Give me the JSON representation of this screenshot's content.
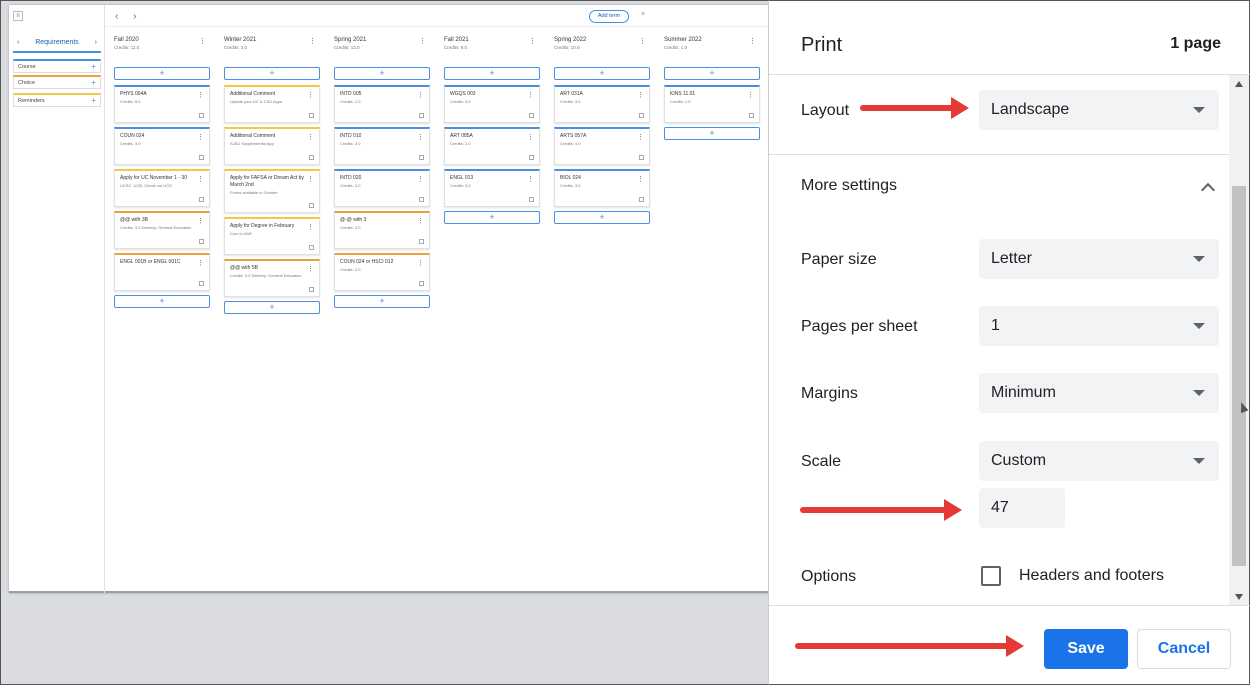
{
  "planner": {
    "sidebar": {
      "menu_icon": "≡",
      "requirements_label": "Requirements",
      "items": [
        {
          "label": "Course",
          "color": "#4a8fe0"
        },
        {
          "label": "Choice",
          "color": "#e8a33c"
        },
        {
          "label": "Reminders",
          "color": "#f0c94a"
        }
      ]
    },
    "add_term_label": "Add term",
    "close_glyph": "×",
    "terms": [
      {
        "name": "Fall 2020",
        "credits": "Credits: 11.0",
        "cards": [
          {
            "title": "PHYS 004A",
            "sub": "Credits: 5.0",
            "color": "#4a8fe0"
          },
          {
            "title": "COUN 024",
            "sub": "Credits: 3.0",
            "color": "#4a8fe0"
          },
          {
            "title": "Apply for UC November 1 - 30",
            "sub": "UCSC, UCB, Check out UCD",
            "color": "#f0c94a"
          },
          {
            "title": "@@ with 3B",
            "sub": "Credits: 3.0 Delivery: General Education",
            "color": "#e8a33c"
          },
          {
            "title": "ENGL 001B or ENGL 001C",
            "sub": "",
            "color": "#e8a33c"
          }
        ]
      },
      {
        "name": "Winter 2021",
        "credits": "Credits: 3.0",
        "cards": [
          {
            "title": "Additional Comment",
            "sub": "Update your UC & CSU Apps",
            "color": "#f0c94a"
          },
          {
            "title": "Additional Comment",
            "sub": "SJSU Supplemental App",
            "color": "#f0c94a"
          },
          {
            "title": "Apply for FAFSA or Dream Act by March 2nd",
            "sub": "Forms available in October",
            "color": "#f0c94a"
          },
          {
            "title": "Apply for Degree in February",
            "sub": "Cum in AAR",
            "color": "#f0c94a"
          },
          {
            "title": "@@ with 5B",
            "sub": "Credits: 3.0 Delivery: General Education",
            "color": "#e8a33c"
          }
        ]
      },
      {
        "name": "Spring 2021",
        "credits": "Credits: 13.0",
        "cards": [
          {
            "title": "INTD 005",
            "sub": "Credits: 1.0",
            "color": "#4a8fe0"
          },
          {
            "title": "INTD 010",
            "sub": "Credits: 3.0",
            "color": "#4a8fe0"
          },
          {
            "title": "INTD 020",
            "sub": "Credits: 3.0",
            "color": "#4a8fe0"
          },
          {
            "title": "@-@ with 3",
            "sub": "Credits: 3.0",
            "color": "#e8a33c"
          },
          {
            "title": "COUN 024 or HSCI 012",
            "sub": "Credits: 3.0",
            "color": "#e8a33c"
          }
        ]
      },
      {
        "name": "Fall 2021",
        "credits": "Credits: 9.0",
        "cards": [
          {
            "title": "WGQS 003",
            "sub": "Credits: 3.0",
            "color": "#4a8fe0"
          },
          {
            "title": "ART 085A",
            "sub": "Credits: 3.0",
            "color": "#4a8fe0"
          },
          {
            "title": "ENGL 013",
            "sub": "Credits: 3.0",
            "color": "#4a8fe0"
          }
        ]
      },
      {
        "name": "Spring 2022",
        "credits": "Credits: 10.0",
        "cards": [
          {
            "title": "ART 031A",
            "sub": "Credits: 3.0",
            "color": "#4a8fe0"
          },
          {
            "title": "ARTS 057A",
            "sub": "Credits: 4.0",
            "color": "#4a8fe0"
          },
          {
            "title": "BIOL 024",
            "sub": "Credits: 3.0",
            "color": "#4a8fe0"
          }
        ]
      },
      {
        "name": "Summer 2022",
        "credits": "Credits: 1.0",
        "cards": [
          {
            "title": "KINS 11.01",
            "sub": "Credits: 1.0",
            "color": "#4a8fe0"
          }
        ]
      }
    ]
  },
  "print": {
    "title": "Print",
    "pages": "1 page",
    "layout_label": "Layout",
    "layout_value": "Landscape",
    "more_settings": "More settings",
    "paper_size_label": "Paper size",
    "paper_size_value": "Letter",
    "pages_per_sheet_label": "Pages per sheet",
    "pages_per_sheet_value": "1",
    "margins_label": "Margins",
    "margins_value": "Minimum",
    "scale_label": "Scale",
    "scale_value": "Custom",
    "scale_percent": "47",
    "options_label": "Options",
    "headers_footers_label": "Headers and footers",
    "save_label": "Save",
    "cancel_label": "Cancel"
  },
  "colors": {
    "primary": "#1a73e8",
    "annotation": "#e53935"
  }
}
